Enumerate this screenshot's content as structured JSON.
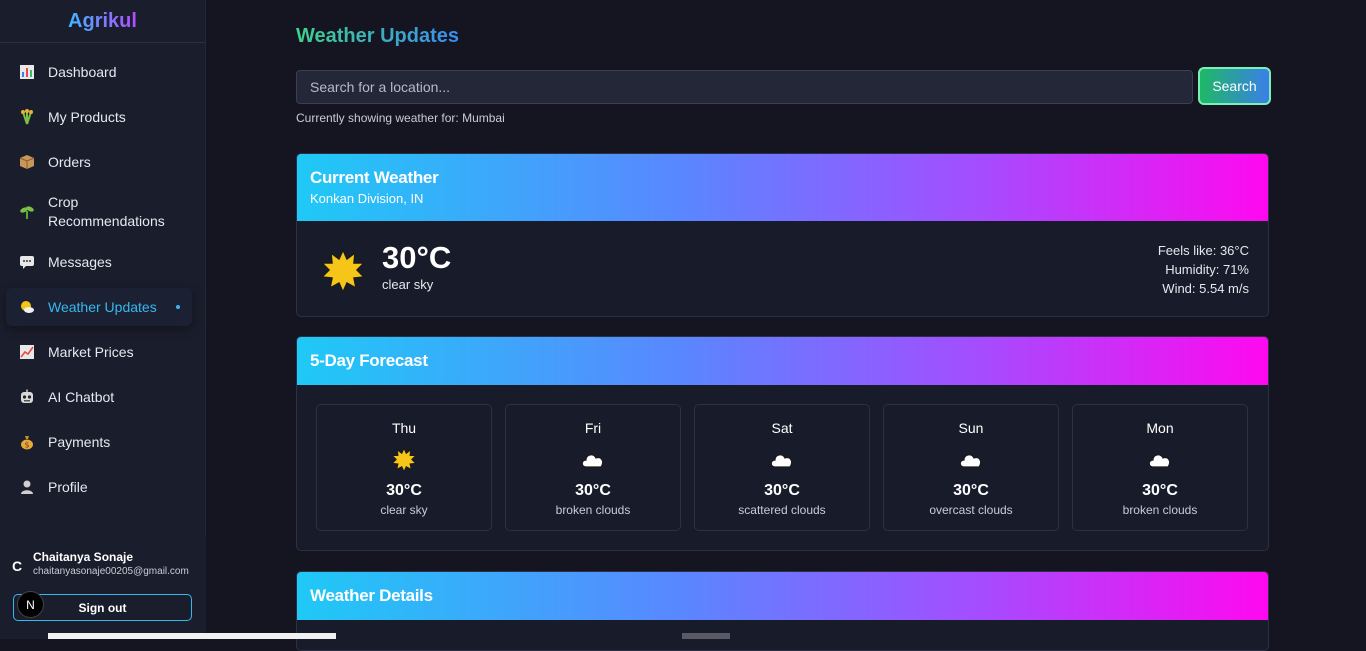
{
  "app": {
    "name": "Agrikul"
  },
  "sidebar": {
    "items": [
      {
        "label": "Dashboard",
        "icon": "bar-chart-icon"
      },
      {
        "label": "My Products",
        "icon": "sheaf-icon"
      },
      {
        "label": "Orders",
        "icon": "package-icon"
      },
      {
        "label": "Crop Recommendations",
        "icon": "seedling-icon"
      },
      {
        "label": "Messages",
        "icon": "speech-bubble-icon"
      },
      {
        "label": "Weather Updates",
        "icon": "sun-cloud-icon",
        "active": true
      },
      {
        "label": "Market Prices",
        "icon": "trend-chart-icon"
      },
      {
        "label": "AI Chatbot",
        "icon": "robot-icon"
      },
      {
        "label": "Payments",
        "icon": "money-bag-icon"
      },
      {
        "label": "Profile",
        "icon": "user-icon"
      }
    ]
  },
  "user": {
    "initial": "C",
    "name": "Chaitanya Sonaje",
    "email": "chaitanyasonaje00205@gmail.com",
    "signout_label": "Sign out",
    "badge": "N"
  },
  "page": {
    "title": "Weather Updates",
    "search_placeholder": "Search for a location...",
    "search_button": "Search",
    "showing_text": "Currently showing weather for: Mumbai"
  },
  "current": {
    "title": "Current Weather",
    "location": "Konkan Division, IN",
    "temp": "30°C",
    "condition": "clear sky",
    "feels_like": "Feels like: 36°C",
    "humidity": "Humidity: 71%",
    "wind": "Wind: 5.54 m/s",
    "icon": "sun-icon"
  },
  "forecast": {
    "title": "5-Day Forecast",
    "days": [
      {
        "day": "Thu",
        "temp": "30°C",
        "condition": "clear sky",
        "icon": "sun-icon"
      },
      {
        "day": "Fri",
        "temp": "30°C",
        "condition": "broken clouds",
        "icon": "cloud-icon"
      },
      {
        "day": "Sat",
        "temp": "30°C",
        "condition": "scattered clouds",
        "icon": "cloud-icon"
      },
      {
        "day": "Sun",
        "temp": "30°C",
        "condition": "overcast clouds",
        "icon": "cloud-icon"
      },
      {
        "day": "Mon",
        "temp": "30°C",
        "condition": "broken clouds",
        "icon": "cloud-icon"
      }
    ]
  },
  "details": {
    "title": "Weather Details"
  },
  "colors": {
    "accent": "#35b8f0",
    "background": "#151421",
    "sidebar": "#1a1d2b",
    "header_gradient_start": "#1fc9f6",
    "header_gradient_end": "#ff08f0"
  }
}
